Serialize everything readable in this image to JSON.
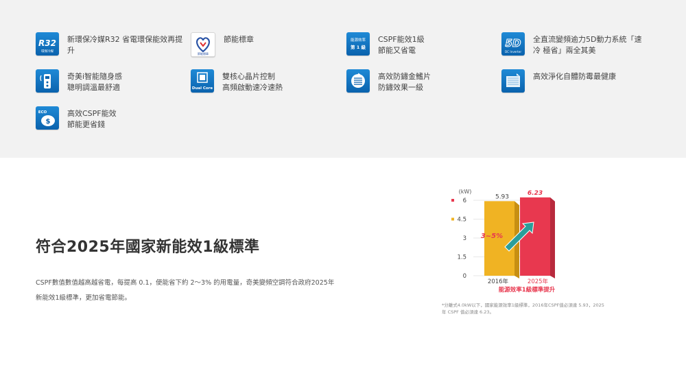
{
  "features": [
    {
      "name": "feature-r32",
      "icon": "r32-refrigerant-icon",
      "icon_text": "R32",
      "icon_subtext": "環保冷媒",
      "text": "新環保冷媒R32 省電環保能效再提\n升"
    },
    {
      "name": "feature-energy-label",
      "icon": "energy-label-icon",
      "icon_text": "節能標章",
      "text": "節能標章"
    },
    {
      "name": "feature-cspf-level1",
      "icon": "level1-badge-icon",
      "icon_text": "能源效率",
      "icon_subtext": "第 1 級",
      "text": "CSPF能效1級\n節能又省電"
    },
    {
      "name": "feature-5d-inverter",
      "icon": "5d-inverter-icon",
      "icon_text": "5D",
      "icon_subtext": "DC Inverter",
      "text": "全直流變頻逾力5D動力系統「速\n冷 極省」兩全其美"
    },
    {
      "name": "feature-smart-remote",
      "icon": "smart-remote-icon",
      "text": "奇美i智能隨身感\n聰明調溫最舒適"
    },
    {
      "name": "feature-dual-core",
      "icon": "dual-core-chip-icon",
      "icon_text": "Dual Core",
      "text": "雙核心晶片控制\n高頻啟動速冷速熱"
    },
    {
      "name": "feature-anticorrosion",
      "icon": "anticorrosion-fin-icon",
      "text": "高效防鏽金鰭片\n防鏽效果一級"
    },
    {
      "name": "feature-self-clean",
      "icon": "self-clean-icon",
      "text": "高效淨化自體防霉最健康"
    },
    {
      "name": "feature-eco-saving",
      "icon": "eco-piggy-bank-icon",
      "icon_text": "ECO",
      "text": "高效CSPF能效\n節能更省錢"
    }
  ],
  "section": {
    "headline": "符合2025年國家新能效1級標準",
    "description": "CSPF數值數值越高越省電，每提高 0.1，便能省下約 2～3% 的用電量，奇美變頻空調符合政府2025年新能效1級標準，更加省電節能。"
  },
  "chart_data": {
    "type": "bar",
    "unit_label": "(kW)",
    "categories": [
      "2016年",
      "2025年"
    ],
    "values": [
      5.93,
      6.23
    ],
    "value_labels": [
      "5.93",
      "6.23"
    ],
    "ylim": [
      0,
      6
    ],
    "yticks": [
      "0",
      "1.5",
      "3",
      "4.5",
      "6"
    ],
    "bar_colors": [
      "#f0b323",
      "#e8384f"
    ],
    "annotation": "3~5%",
    "xlabel": "能源效率1級標準提升",
    "tick_marker_colors": {
      "6": "#e8384f",
      "4.5": "#f0b323"
    },
    "footnote": "*分離式4.0kW以下，國家能源效率1級標準，2016年CSPF值必須達 5.93，2025 年 CSPF 值必須達 6.23。"
  },
  "colors": {
    "icon_blue": "#0a62ad",
    "bar_2016": "#f0b323",
    "bar_2025": "#e8384f",
    "arrow_teal": "#2a9e9a",
    "headline_red": "#e8384f"
  }
}
